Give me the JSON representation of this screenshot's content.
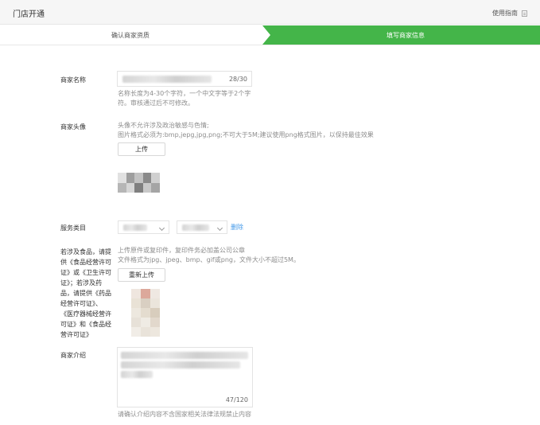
{
  "header": {
    "title": "门店开通",
    "guide_label": "使用指南",
    "guide_icon": "document-icon"
  },
  "steps": [
    {
      "label": "确认商家资质",
      "active": false
    },
    {
      "label": "填写商家信息",
      "active": true
    }
  ],
  "colors": {
    "accent": "#44b549",
    "link": "#459ae9"
  },
  "form": {
    "name": {
      "label": "商家名称",
      "counter": "28/30",
      "hint_line1": "名称长度为4-30个字符，一个中文字等于2个字",
      "hint_line2": "符。审核通过后不可修改。"
    },
    "avatar": {
      "label": "商家头像",
      "hint_line1": "头像不允许涉及政治敏感与色情;",
      "hint_line2": "图片格式必须为:bmp,jepg,jpg,png;不可大于5M;建议使用png格式图片，以保持最佳效果",
      "upload_label": "上传"
    },
    "category": {
      "label": "服务类目",
      "delete_label": "删除"
    },
    "license": {
      "label_lines": [
        "若涉及食品，请提",
        "供《食品经营许可",
        "证》或《卫生许可",
        "证》；若涉及药",
        "品，请提供《药品",
        "经营许可证》、",
        "《医疗器械经营许",
        "可证》和《食品经",
        "营许可证》"
      ],
      "hint_line1": "上传原件或复印件，复印件务必加盖公司公章",
      "hint_line2": "文件格式为jpg、jpeg、bmp、gif或png，文件大小不超过5M。",
      "reupload_label": "重新上传"
    },
    "intro": {
      "label": "商家介绍",
      "counter": "47/120",
      "hint": "请确认介绍内容不含国家相关法律法规禁止内容"
    }
  }
}
